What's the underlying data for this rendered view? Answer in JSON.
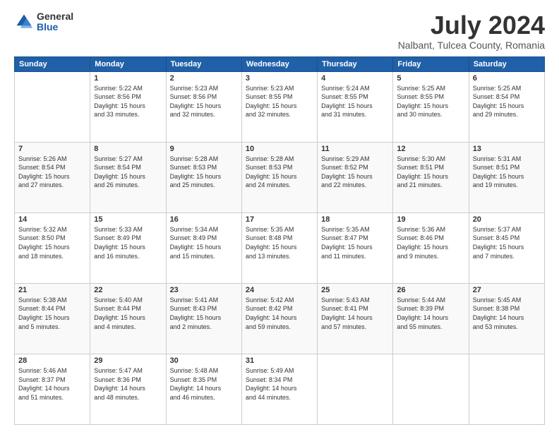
{
  "logo": {
    "general": "General",
    "blue": "Blue"
  },
  "header": {
    "month": "July 2024",
    "location": "Nalbant, Tulcea County, Romania"
  },
  "days_of_week": [
    "Sunday",
    "Monday",
    "Tuesday",
    "Wednesday",
    "Thursday",
    "Friday",
    "Saturday"
  ],
  "weeks": [
    [
      {
        "day": "",
        "info": ""
      },
      {
        "day": "1",
        "info": "Sunrise: 5:22 AM\nSunset: 8:56 PM\nDaylight: 15 hours\nand 33 minutes."
      },
      {
        "day": "2",
        "info": "Sunrise: 5:23 AM\nSunset: 8:56 PM\nDaylight: 15 hours\nand 32 minutes."
      },
      {
        "day": "3",
        "info": "Sunrise: 5:23 AM\nSunset: 8:55 PM\nDaylight: 15 hours\nand 32 minutes."
      },
      {
        "day": "4",
        "info": "Sunrise: 5:24 AM\nSunset: 8:55 PM\nDaylight: 15 hours\nand 31 minutes."
      },
      {
        "day": "5",
        "info": "Sunrise: 5:25 AM\nSunset: 8:55 PM\nDaylight: 15 hours\nand 30 minutes."
      },
      {
        "day": "6",
        "info": "Sunrise: 5:25 AM\nSunset: 8:54 PM\nDaylight: 15 hours\nand 29 minutes."
      }
    ],
    [
      {
        "day": "7",
        "info": "Sunrise: 5:26 AM\nSunset: 8:54 PM\nDaylight: 15 hours\nand 27 minutes."
      },
      {
        "day": "8",
        "info": "Sunrise: 5:27 AM\nSunset: 8:54 PM\nDaylight: 15 hours\nand 26 minutes."
      },
      {
        "day": "9",
        "info": "Sunrise: 5:28 AM\nSunset: 8:53 PM\nDaylight: 15 hours\nand 25 minutes."
      },
      {
        "day": "10",
        "info": "Sunrise: 5:28 AM\nSunset: 8:53 PM\nDaylight: 15 hours\nand 24 minutes."
      },
      {
        "day": "11",
        "info": "Sunrise: 5:29 AM\nSunset: 8:52 PM\nDaylight: 15 hours\nand 22 minutes."
      },
      {
        "day": "12",
        "info": "Sunrise: 5:30 AM\nSunset: 8:51 PM\nDaylight: 15 hours\nand 21 minutes."
      },
      {
        "day": "13",
        "info": "Sunrise: 5:31 AM\nSunset: 8:51 PM\nDaylight: 15 hours\nand 19 minutes."
      }
    ],
    [
      {
        "day": "14",
        "info": "Sunrise: 5:32 AM\nSunset: 8:50 PM\nDaylight: 15 hours\nand 18 minutes."
      },
      {
        "day": "15",
        "info": "Sunrise: 5:33 AM\nSunset: 8:49 PM\nDaylight: 15 hours\nand 16 minutes."
      },
      {
        "day": "16",
        "info": "Sunrise: 5:34 AM\nSunset: 8:49 PM\nDaylight: 15 hours\nand 15 minutes."
      },
      {
        "day": "17",
        "info": "Sunrise: 5:35 AM\nSunset: 8:48 PM\nDaylight: 15 hours\nand 13 minutes."
      },
      {
        "day": "18",
        "info": "Sunrise: 5:35 AM\nSunset: 8:47 PM\nDaylight: 15 hours\nand 11 minutes."
      },
      {
        "day": "19",
        "info": "Sunrise: 5:36 AM\nSunset: 8:46 PM\nDaylight: 15 hours\nand 9 minutes."
      },
      {
        "day": "20",
        "info": "Sunrise: 5:37 AM\nSunset: 8:45 PM\nDaylight: 15 hours\nand 7 minutes."
      }
    ],
    [
      {
        "day": "21",
        "info": "Sunrise: 5:38 AM\nSunset: 8:44 PM\nDaylight: 15 hours\nand 5 minutes."
      },
      {
        "day": "22",
        "info": "Sunrise: 5:40 AM\nSunset: 8:44 PM\nDaylight: 15 hours\nand 4 minutes."
      },
      {
        "day": "23",
        "info": "Sunrise: 5:41 AM\nSunset: 8:43 PM\nDaylight: 15 hours\nand 2 minutes."
      },
      {
        "day": "24",
        "info": "Sunrise: 5:42 AM\nSunset: 8:42 PM\nDaylight: 14 hours\nand 59 minutes."
      },
      {
        "day": "25",
        "info": "Sunrise: 5:43 AM\nSunset: 8:41 PM\nDaylight: 14 hours\nand 57 minutes."
      },
      {
        "day": "26",
        "info": "Sunrise: 5:44 AM\nSunset: 8:39 PM\nDaylight: 14 hours\nand 55 minutes."
      },
      {
        "day": "27",
        "info": "Sunrise: 5:45 AM\nSunset: 8:38 PM\nDaylight: 14 hours\nand 53 minutes."
      }
    ],
    [
      {
        "day": "28",
        "info": "Sunrise: 5:46 AM\nSunset: 8:37 PM\nDaylight: 14 hours\nand 51 minutes."
      },
      {
        "day": "29",
        "info": "Sunrise: 5:47 AM\nSunset: 8:36 PM\nDaylight: 14 hours\nand 48 minutes."
      },
      {
        "day": "30",
        "info": "Sunrise: 5:48 AM\nSunset: 8:35 PM\nDaylight: 14 hours\nand 46 minutes."
      },
      {
        "day": "31",
        "info": "Sunrise: 5:49 AM\nSunset: 8:34 PM\nDaylight: 14 hours\nand 44 minutes."
      },
      {
        "day": "",
        "info": ""
      },
      {
        "day": "",
        "info": ""
      },
      {
        "day": "",
        "info": ""
      }
    ]
  ]
}
